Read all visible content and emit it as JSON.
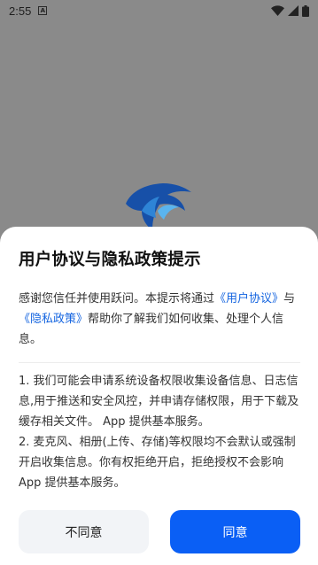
{
  "status_bar": {
    "time": "2:55",
    "notification_icon_letter": "A",
    "icons": [
      "wifi-icon",
      "signal-icon",
      "battery-icon"
    ]
  },
  "background": {
    "logo": "dolphin-logo"
  },
  "dialog": {
    "title": "用户协议与隐私政策提示",
    "intro_prefix": "感谢您信任并使用跃问。本提示将通过",
    "link_user_agreement": "《用户协议》",
    "intro_and": "与",
    "link_privacy_policy": "《隐私政策》",
    "intro_suffix": "帮助你了解我们如何收集、处理个人信息。",
    "point_1": "1. 我们可能会申请系统设备权限收集设备信息、日志信息,用于推送和安全风控，并申请存储权限，用于下载及缓存相关文件。 App 提供基本服务。",
    "point_2": "2. 麦克风、相册(上传、存储)等权限均不会默认或强制开启收集信息。你有权拒绝开启，拒绝授权不会影响 App 提供基本服务。",
    "disagree_label": "不同意",
    "agree_label": "同意"
  },
  "colors": {
    "overlay": "#8a8a8a",
    "link": "#1565e0",
    "primary_button": "#0a5ff5",
    "secondary_button": "#f2f4f7"
  }
}
